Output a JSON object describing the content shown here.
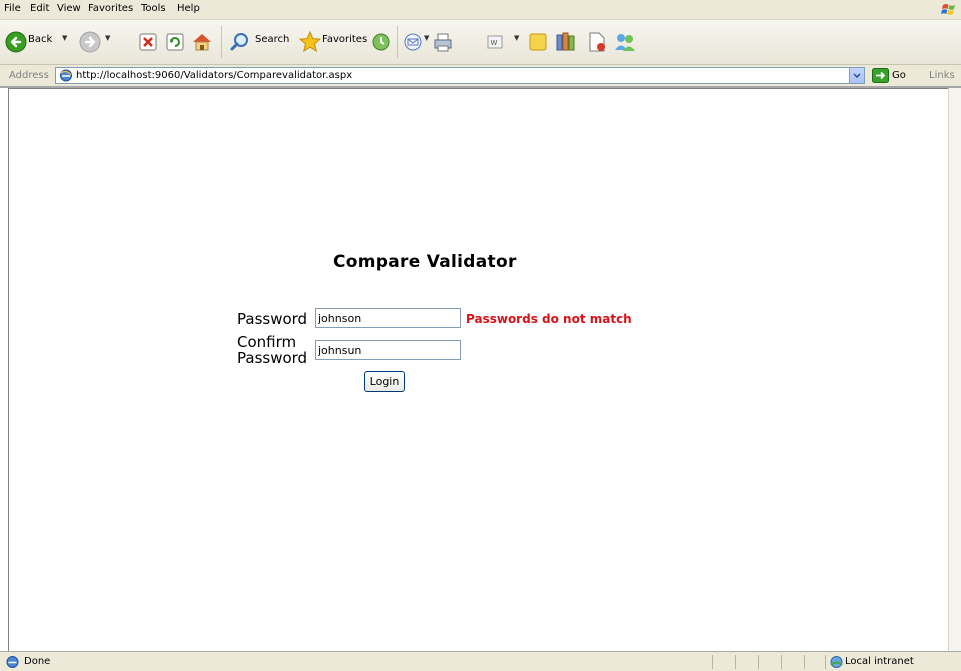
{
  "menu": [
    "File",
    "Edit",
    "View",
    "Favorites",
    "Tools",
    "Help"
  ],
  "toolbar": {
    "back_label": "Back",
    "search_label": "Search",
    "favorites_label": "Favorites"
  },
  "address": {
    "label": "Address",
    "url": "http://localhost:9060/Validators/Comparevalidator.aspx",
    "go_label": "Go",
    "links_label": "Links"
  },
  "page": {
    "title": "Compare Validator",
    "password_label": "Password",
    "password_value": "johnson",
    "error_message": "Passwords do not match",
    "confirm_label_line1": "Confirm",
    "confirm_label_line2": "Password",
    "confirm_value": "johnsun",
    "login_label": "Login"
  },
  "status": {
    "text": "Done",
    "zone": "Local intranet"
  }
}
